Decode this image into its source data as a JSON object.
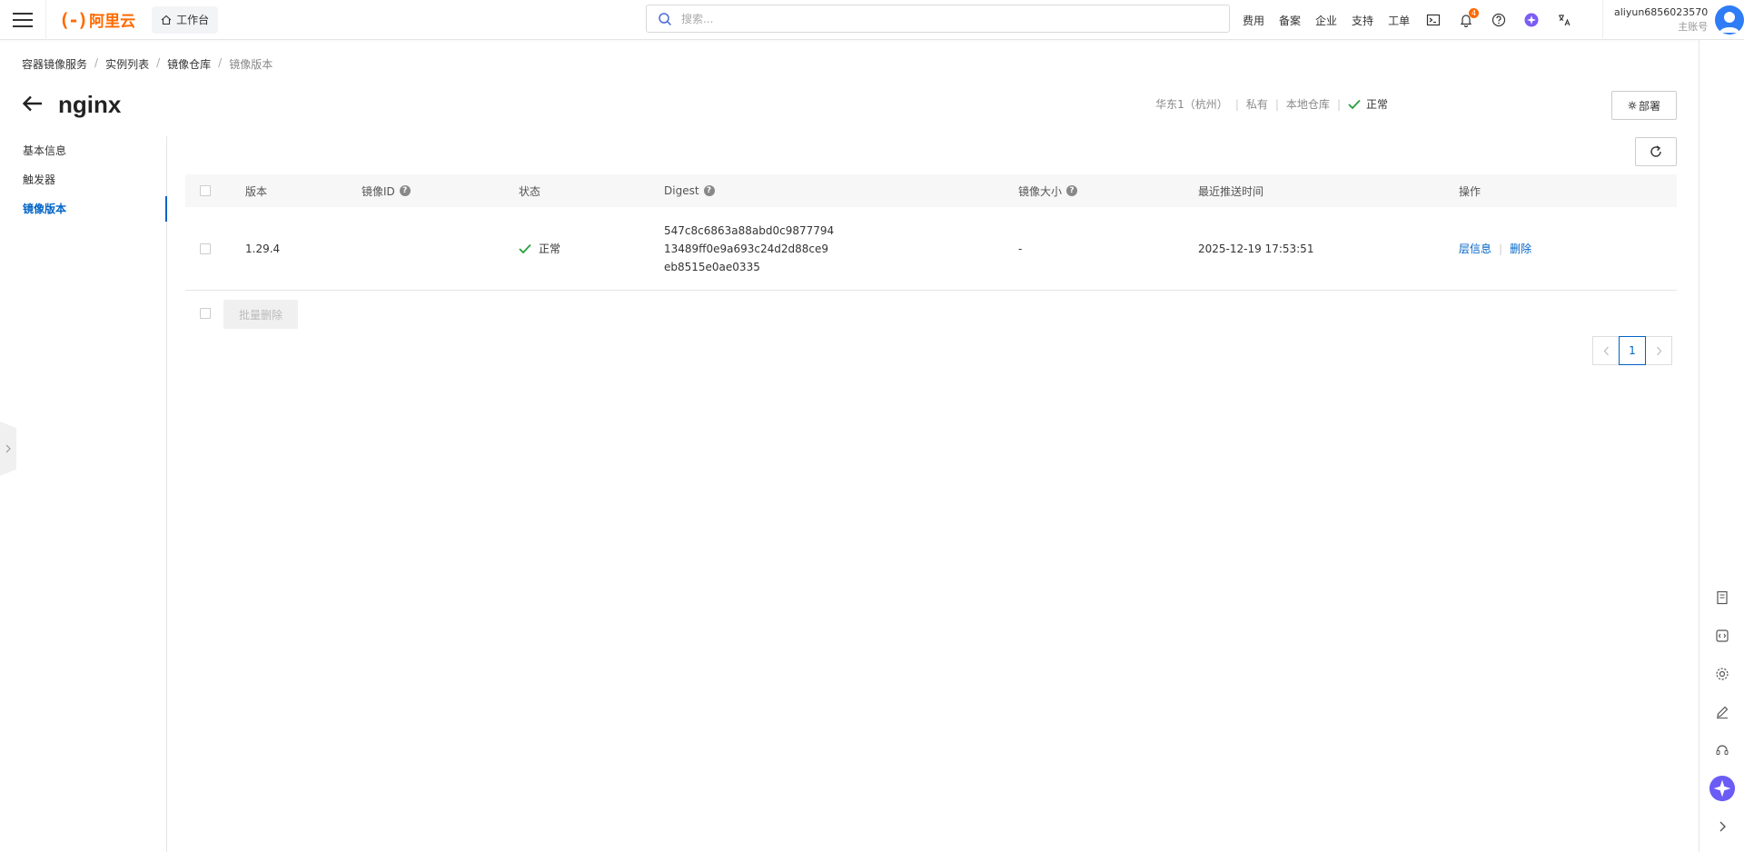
{
  "topbar": {
    "logo_mark": "(-)",
    "logo_text": "阿里云",
    "workbench": "工作台",
    "search_placeholder": "搜索...",
    "nav": [
      "费用",
      "备案",
      "企业",
      "支持",
      "工单"
    ],
    "notification_count": "4",
    "user_name": "aliyun6856023570",
    "user_role": "主账号"
  },
  "breadcrumb": [
    "容器镜像服务",
    "实例列表",
    "镜像仓库",
    "镜像版本"
  ],
  "page": {
    "title": "nginx",
    "region": "华东1（杭州）",
    "visibility": "私有",
    "repo_type": "本地仓库",
    "status": "正常",
    "deploy_label": "部署"
  },
  "leftnav": [
    "基本信息",
    "触发器",
    "镜像版本"
  ],
  "table": {
    "headers": [
      "版本",
      "镜像ID",
      "状态",
      "Digest",
      "镜像大小",
      "最近推送时间",
      "操作"
    ],
    "help_mark": "?",
    "rows": [
      {
        "version": "1.29.4",
        "image_id": "",
        "status": "正常",
        "digest": [
          "547c8c6863a88abd0c9877794",
          "13489ff0e9a693c24d2d88ce9",
          "eb8515e0ae0335"
        ],
        "size": "-",
        "pushed": "2025-12-19 17:53:51",
        "actions": [
          "层信息",
          "删除"
        ]
      }
    ]
  },
  "batch_delete": "批量删除",
  "pager": {
    "current": "1"
  },
  "colors": {
    "accent": "#0064c8",
    "brand": "#ff6a00",
    "success": "#23a03c"
  }
}
